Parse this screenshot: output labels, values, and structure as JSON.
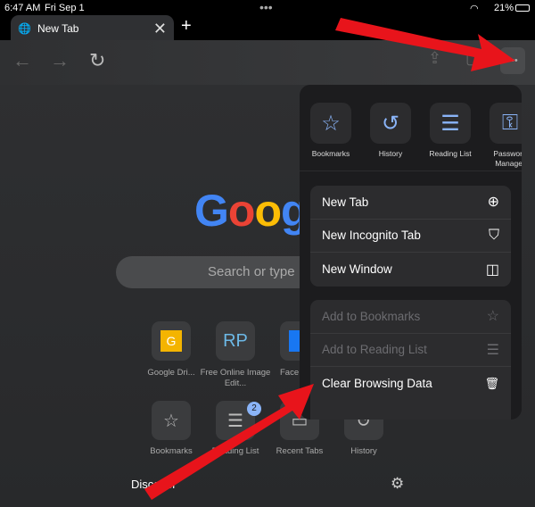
{
  "status": {
    "time": "6:47 AM",
    "date": "Fri Sep 1",
    "battery": "21%"
  },
  "tab": {
    "title": "New Tab"
  },
  "google": {
    "letters": [
      "G",
      "o",
      "o",
      "g"
    ],
    "colors": [
      "#4285f4",
      "#ea4335",
      "#fbbc05",
      "#4285f4"
    ]
  },
  "search": {
    "placeholder": "Search or type"
  },
  "shortcuts": [
    {
      "label": "Google Dri...",
      "glyph": "G"
    },
    {
      "label": "Free Online Image Edit...",
      "glyph": "RP"
    },
    {
      "label": "Face",
      "glyph": "f"
    }
  ],
  "shortcuts2": [
    {
      "label": "Bookmarks"
    },
    {
      "label": "Reading List",
      "badge": "2"
    },
    {
      "label": "Recent Tabs"
    },
    {
      "label": "History"
    }
  ],
  "discover": "Discover",
  "menu": {
    "quick": [
      {
        "label": "Bookmarks",
        "icon": "star-icon"
      },
      {
        "label": "History",
        "icon": "history-icon"
      },
      {
        "label": "Reading List",
        "icon": "list-icon"
      },
      {
        "label": "Password Manager",
        "icon": "key-icon"
      }
    ],
    "group1": [
      {
        "label": "New Tab",
        "icon": "⊕"
      },
      {
        "label": "New Incognito Tab",
        "icon": "⛉"
      },
      {
        "label": "New Window",
        "icon": "◫"
      }
    ],
    "group2": [
      {
        "label": "Add to Bookmarks",
        "icon": "☆",
        "disabled": true
      },
      {
        "label": "Add to Reading List",
        "icon": "☰",
        "disabled": true
      },
      {
        "label": "Clear Browsing Data",
        "icon": "🗑",
        "disabled": false
      }
    ]
  },
  "accent": "#8ab4f8",
  "arrow_color": "#e8141b"
}
